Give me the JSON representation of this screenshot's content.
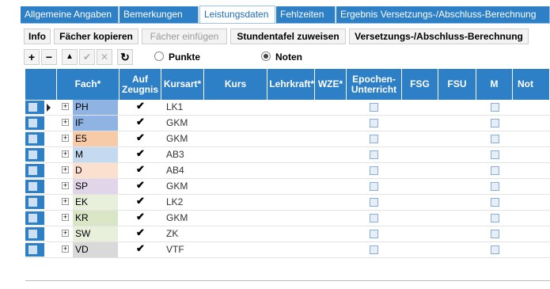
{
  "tabs": [
    {
      "label": "Allgemeine Angaben",
      "active": false
    },
    {
      "label": "Bemerkungen",
      "active": false
    },
    {
      "label": "Leistungsdaten",
      "active": true
    },
    {
      "label": "Fehlzeiten",
      "active": false
    },
    {
      "label": "Ergebnis Versetzungs-/Abschluss-Berechnung",
      "active": false
    }
  ],
  "toolbar": {
    "info": "Info",
    "copy_subjects": "Fächer kopieren",
    "paste_subjects": "Fächer einfügen",
    "assign_timetable": "Stundentafel zuweisen",
    "calculation": "Versetzungs-/Abschluss-Berechnung"
  },
  "icons": {
    "add": "+",
    "remove": "−",
    "up": "▲",
    "confirm": "✔",
    "cancel": "✕",
    "refresh": "↻"
  },
  "grade_mode": {
    "points_label": "Punkte",
    "grades_label": "Noten",
    "selected": "Noten"
  },
  "grid": {
    "headers": [
      "Fach*",
      "Auf\nZeugnis",
      "Kursart*",
      "Kurs",
      "Lehrkraft*",
      "WZE*",
      "Epochen-\nUnterricht",
      "FSG",
      "FSU",
      "M",
      "Not"
    ],
    "header_colors": {
      "header_bg": "#2d7fc6",
      "header_text": "#ffffff"
    },
    "rows": [
      {
        "fach": "PH",
        "color": "#8fb4e3",
        "auf_zeugnis": true,
        "kursart": "LK1",
        "selected": true
      },
      {
        "fach": "IF",
        "color": "#8fb4e3",
        "auf_zeugnis": true,
        "kursart": "GKM",
        "selected": false
      },
      {
        "fach": "E5",
        "color": "#f8cba8",
        "auf_zeugnis": true,
        "kursart": "GKM",
        "selected": false
      },
      {
        "fach": "M",
        "color": "#c5d9f1",
        "auf_zeugnis": true,
        "kursart": "AB3",
        "selected": false
      },
      {
        "fach": "D",
        "color": "#fbe0d0",
        "auf_zeugnis": true,
        "kursart": "AB4",
        "selected": false
      },
      {
        "fach": "SP",
        "color": "#e1d5ea",
        "auf_zeugnis": true,
        "kursart": "GKM",
        "selected": false
      },
      {
        "fach": "EK",
        "color": "#e8f0dc",
        "auf_zeugnis": true,
        "kursart": "LK2",
        "selected": false
      },
      {
        "fach": "KR",
        "color": "#d9e6c6",
        "auf_zeugnis": true,
        "kursart": "GKM",
        "selected": false
      },
      {
        "fach": "SW",
        "color": "#e8f0dc",
        "auf_zeugnis": true,
        "kursart": "ZK",
        "selected": false
      },
      {
        "fach": "VD",
        "color": "#d9d9d9",
        "auf_zeugnis": true,
        "kursart": "VTF",
        "selected": false
      }
    ]
  }
}
